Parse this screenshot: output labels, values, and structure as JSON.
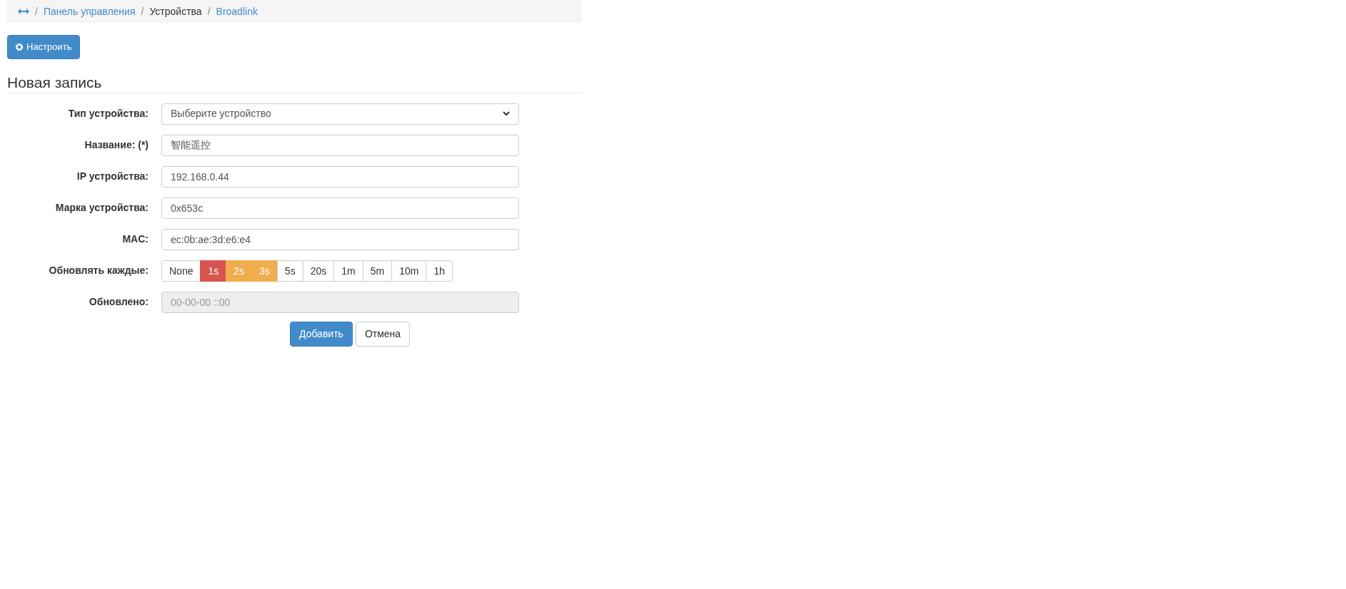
{
  "breadcrumb": [
    {
      "separator": "/",
      "label": "Панель управления",
      "link": true
    },
    {
      "separator": "/",
      "label": "Устройства",
      "link": false
    },
    {
      "separator": "/",
      "label": "Broadlink",
      "link": true
    }
  ],
  "setup_button": {
    "label": "Настроить"
  },
  "heading": "Новая запись",
  "form": {
    "fields": [
      {
        "kind": "select",
        "label": "Тип устройства:",
        "value": "Выберите устройство"
      },
      {
        "kind": "input",
        "label": "Название: (*)",
        "value": "智能遥控"
      },
      {
        "kind": "input",
        "label": "IP устройства:",
        "value": "192.168.0.44"
      },
      {
        "kind": "input",
        "label": "Марка устройства:",
        "value": "0x653c"
      },
      {
        "kind": "input",
        "label": "MAC:",
        "value": "ec:0b:ae:3d:e6:e4"
      },
      {
        "kind": "interval",
        "label": "Обновлять каждые:",
        "options": [
          {
            "label": "None",
            "color": "#ffffff"
          },
          {
            "label": "1s",
            "color": "#d9534f"
          },
          {
            "label": "2s",
            "color": "#f0ad4e"
          },
          {
            "label": "3s",
            "color": "#f0ad4e"
          },
          {
            "label": "5s",
            "color": "#ffffff"
          },
          {
            "label": "20s",
            "color": "#ffffff"
          },
          {
            "label": "1m",
            "color": "#ffffff"
          },
          {
            "label": "5m",
            "color": "#ffffff"
          },
          {
            "label": "10m",
            "color": "#ffffff"
          },
          {
            "label": "1h",
            "color": "#ffffff"
          }
        ]
      },
      {
        "kind": "readonly",
        "label": "Обновлено:",
        "value": "00-00-00 ::00"
      }
    ],
    "buttons": [
      {
        "label": "Добавить",
        "kind": "primary"
      },
      {
        "label": "Отмена",
        "kind": "default"
      }
    ]
  }
}
